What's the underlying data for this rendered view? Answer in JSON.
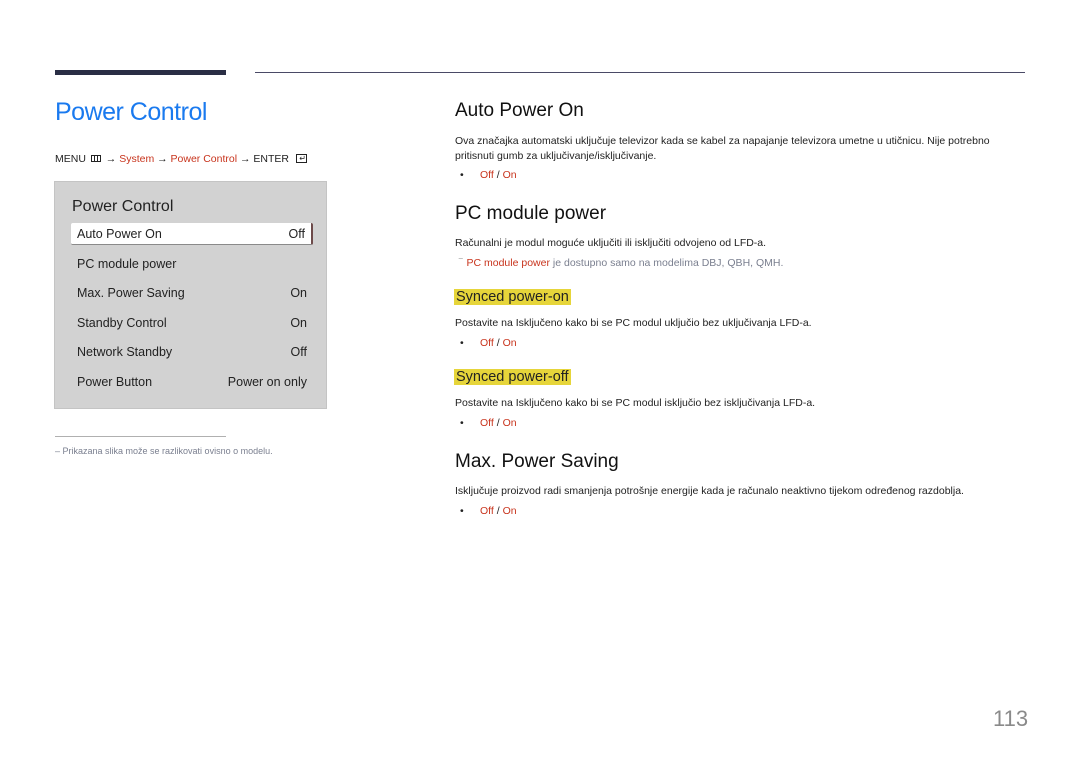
{
  "page_title": "Power Control",
  "breadcrumb": {
    "menu": "MENU",
    "arrow": "→",
    "system": "System",
    "power_control": "Power Control",
    "enter": "ENTER"
  },
  "panel": {
    "title": "Power Control",
    "items": [
      {
        "label": "Auto Power On",
        "value": "Off",
        "selected": true
      },
      {
        "label": "PC module power",
        "value": ""
      },
      {
        "label": "Max. Power Saving",
        "value": "On"
      },
      {
        "label": "Standby Control",
        "value": "On"
      },
      {
        "label": "Network Standby",
        "value": "Off"
      },
      {
        "label": "Power Button",
        "value": "Power on only"
      }
    ]
  },
  "footnote": "–  Prikazana slika može se razlikovati ovisno o modelu.",
  "options": {
    "off": "Off",
    "sep": " / ",
    "on": "On"
  },
  "sections": {
    "auto_power_on": {
      "title": "Auto Power On",
      "text": "Ova značajka automatski uključuje televizor kada se kabel za napajanje televizora umetne u utičnicu. Nije potrebno pritisnuti gumb za uključivanje/isključivanje."
    },
    "pc_module_power": {
      "title": "PC module power",
      "text": "Računalni je modul moguće uključiti ili isključiti odvojeno od LFD-a.",
      "note_link": "PC module power",
      "note_rest": " je dostupno samo na modelima DBJ, QBH, QMH."
    },
    "synced_on": {
      "title": "Synced power-on",
      "text": "Postavite na Isključeno kako bi se PC modul uključio bez uključivanja LFD-a."
    },
    "synced_off": {
      "title": "Synced power-off",
      "text": "Postavite na Isključeno kako bi se PC modul isključio bez isključivanja LFD-a."
    },
    "max_power_saving": {
      "title": "Max. Power Saving",
      "text": "Isključuje proizvod radi smanjenja potrošnje energije kada je računalo neaktivno tijekom određenog razdoblja."
    }
  },
  "page_number": "113"
}
